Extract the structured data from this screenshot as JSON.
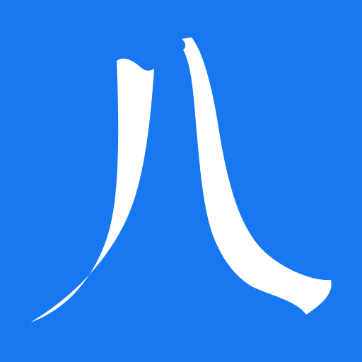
{
  "icon": {
    "glyph": "八",
    "background_color": "#1778F2",
    "glyph_color": "#FFFFFF"
  }
}
